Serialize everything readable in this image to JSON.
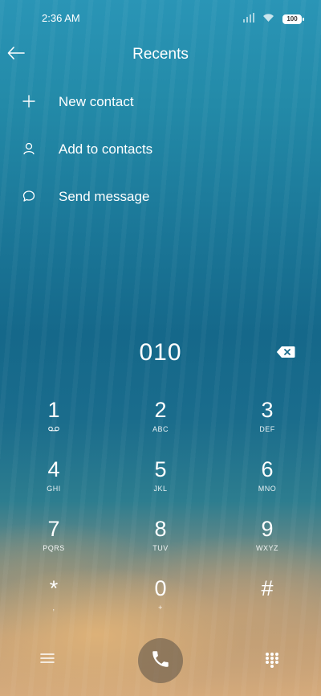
{
  "status_bar": {
    "time": "2:36 AM",
    "battery": "100"
  },
  "header": {
    "title": "Recents"
  },
  "actions": [
    {
      "label": "New contact",
      "icon": "plus-icon"
    },
    {
      "label": "Add to contacts",
      "icon": "person-icon"
    },
    {
      "label": "Send message",
      "icon": "message-icon"
    }
  ],
  "dialer": {
    "number": "010"
  },
  "keypad": [
    {
      "digit": "1",
      "letters": ""
    },
    {
      "digit": "2",
      "letters": "ABC"
    },
    {
      "digit": "3",
      "letters": "DEF"
    },
    {
      "digit": "4",
      "letters": "GHI"
    },
    {
      "digit": "5",
      "letters": "JKL"
    },
    {
      "digit": "6",
      "letters": "MNO"
    },
    {
      "digit": "7",
      "letters": "PQRS"
    },
    {
      "digit": "8",
      "letters": "TUV"
    },
    {
      "digit": "9",
      "letters": "WXYZ"
    },
    {
      "digit": "*",
      "letters": ","
    },
    {
      "digit": "0",
      "letters": "+"
    },
    {
      "digit": "#",
      "letters": ""
    }
  ]
}
